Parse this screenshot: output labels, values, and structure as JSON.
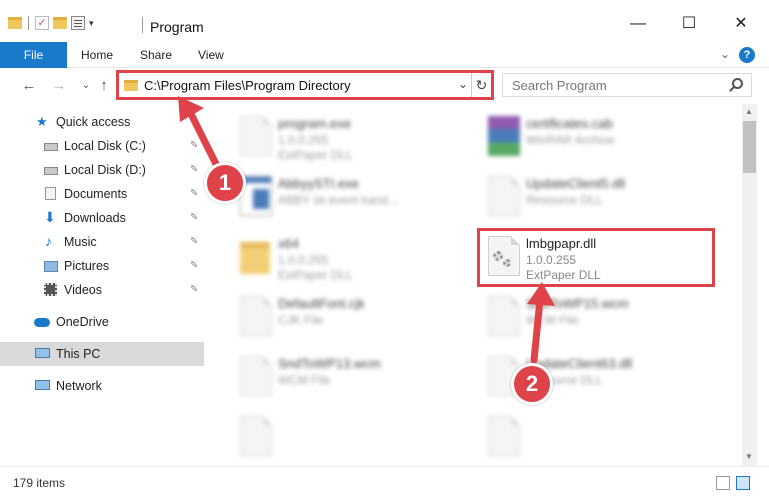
{
  "window": {
    "title": "Program",
    "minimize": "—",
    "maximize": "☐",
    "close": "✕"
  },
  "ribbon": {
    "file": "File",
    "home": "Home",
    "share": "Share",
    "view": "View",
    "help": "?"
  },
  "address": {
    "path": "C:\\Program Files\\Program Directory",
    "search_placeholder": "Search Program"
  },
  "nav": {
    "quick_access": "Quick access",
    "items": [
      {
        "label": "Local Disk (C:)"
      },
      {
        "label": "Local Disk (D:)"
      },
      {
        "label": "Documents"
      },
      {
        "label": "Downloads"
      },
      {
        "label": "Music"
      },
      {
        "label": "Pictures"
      },
      {
        "label": "Videos"
      }
    ],
    "onedrive": "OneDrive",
    "this_pc": "This PC",
    "network": "Network"
  },
  "files": {
    "program_exe": {
      "name": "program.exe",
      "ver": "1.0.0.255",
      "type": "ExtPaper DLL"
    },
    "certificates": {
      "name": "certificates.cab",
      "type": "WinRAR Archive"
    },
    "abbyy": {
      "name": "AbbyySTI.exe",
      "type": "ABBY sti event hand..."
    },
    "update5": {
      "name": "UpdateClient5.dll",
      "type": "Resource DLL"
    },
    "x64": {
      "name": "x64",
      "ver": "1.0.0.255",
      "type": "ExtPaper DLL"
    },
    "target": {
      "name": "lmbgpapr.dll",
      "ver": "1.0.0.255",
      "type": "ExtPaper DLL"
    },
    "defaultfont": {
      "name": "DefaultFont.cjk",
      "type": "CJK File"
    },
    "sndtowp15": {
      "name": "SndToWP15.wcm",
      "type": "WCM File"
    },
    "sndtowp13": {
      "name": "SndToWP13.wcm",
      "type": "WCM File"
    },
    "update63": {
      "name": "UpdateClient63.dll",
      "type": "Resource DLL"
    }
  },
  "status": {
    "count": "179 items"
  },
  "annotations": {
    "step1": "1",
    "step2": "2",
    "color": "#e0424a"
  }
}
